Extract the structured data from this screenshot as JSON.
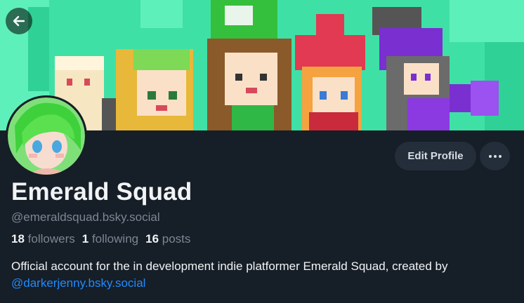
{
  "profile": {
    "display_name": "Emerald Squad",
    "handle": "@emeraldsquad.bsky.social",
    "stats": {
      "followers_count": "18",
      "followers_label": "followers",
      "following_count": "1",
      "following_label": "following",
      "posts_count": "16",
      "posts_label": "posts"
    },
    "bio": {
      "text_before": "Official account for the in development indie platformer Emerald Squad, created by ",
      "mention": "@darkerjenny.bsky.social"
    }
  },
  "actions": {
    "edit_label": "Edit Profile",
    "more_icon": "ellipsis-icon",
    "back_icon": "arrow-left-icon"
  },
  "colors": {
    "background": "#161e27",
    "banner": "#3fe0a6",
    "link": "#208bfe",
    "muted": "#7b8794",
    "button_bg": "#232e3a"
  }
}
